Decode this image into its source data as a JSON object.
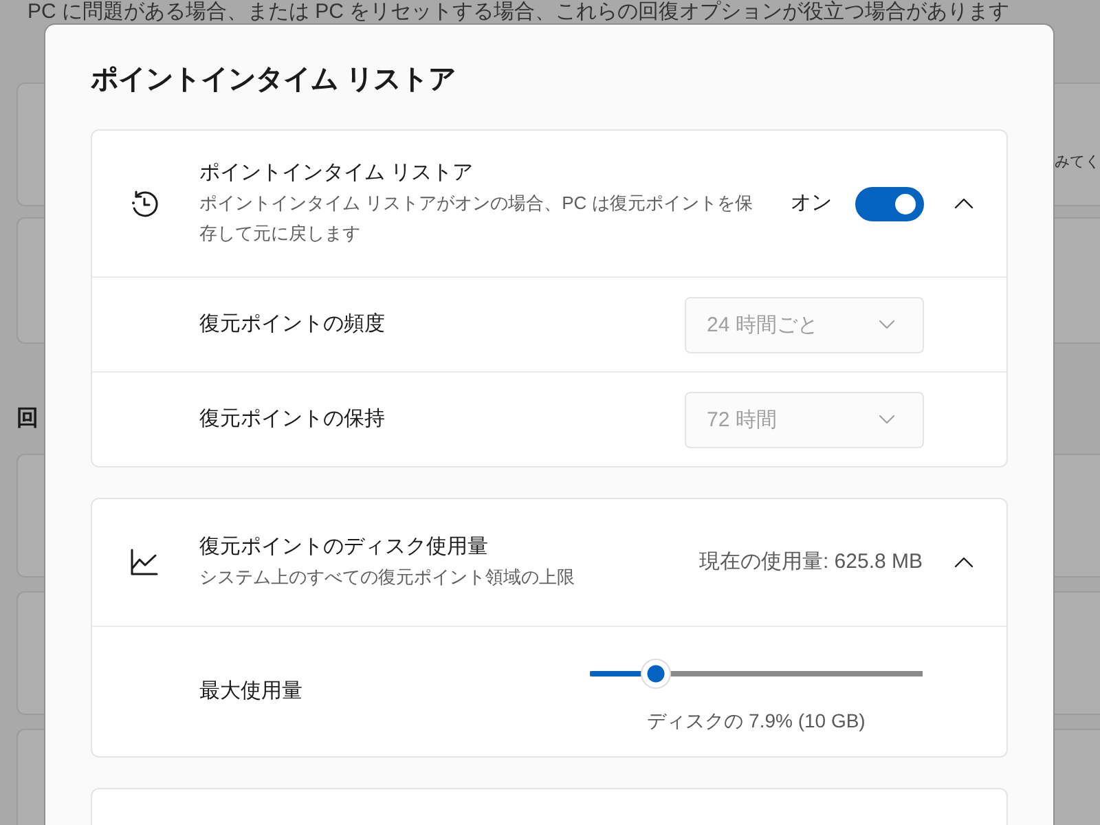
{
  "background": {
    "intro": "PC に問題がある場合、または PC をリセットする場合、これらの回復オプションが役立つ場合があります",
    "card_text": "みてく",
    "section_heading": "回"
  },
  "dialog": {
    "title": "ポイントインタイム リストア",
    "cards": [
      {
        "kind": "toggle",
        "title": "ポイントインタイム リストア",
        "description": "ポイントインタイム リストアがオンの場合、PC は復元ポイントを保存して元に戻します",
        "state_label": "オン",
        "on": true,
        "expanded": true,
        "rows": [
          {
            "kind": "dropdown",
            "label": "復元ポイントの頻度",
            "value": "24 時間ごと",
            "disabled": true
          },
          {
            "kind": "dropdown",
            "label": "復元ポイントの保持",
            "value": "72 時間",
            "disabled": true
          }
        ]
      },
      {
        "kind": "usage",
        "title": "復元ポイントのディスク使用量",
        "description": "システム上のすべての復元ポイント領域の上限",
        "value": "現在の使用量: 625.8 MB",
        "expanded": true,
        "rows": [
          {
            "kind": "slider",
            "label": "最大使用量",
            "level": 0.2,
            "reading": "ディスクの 7.9% (10 GB)"
          }
        ]
      }
    ]
  }
}
